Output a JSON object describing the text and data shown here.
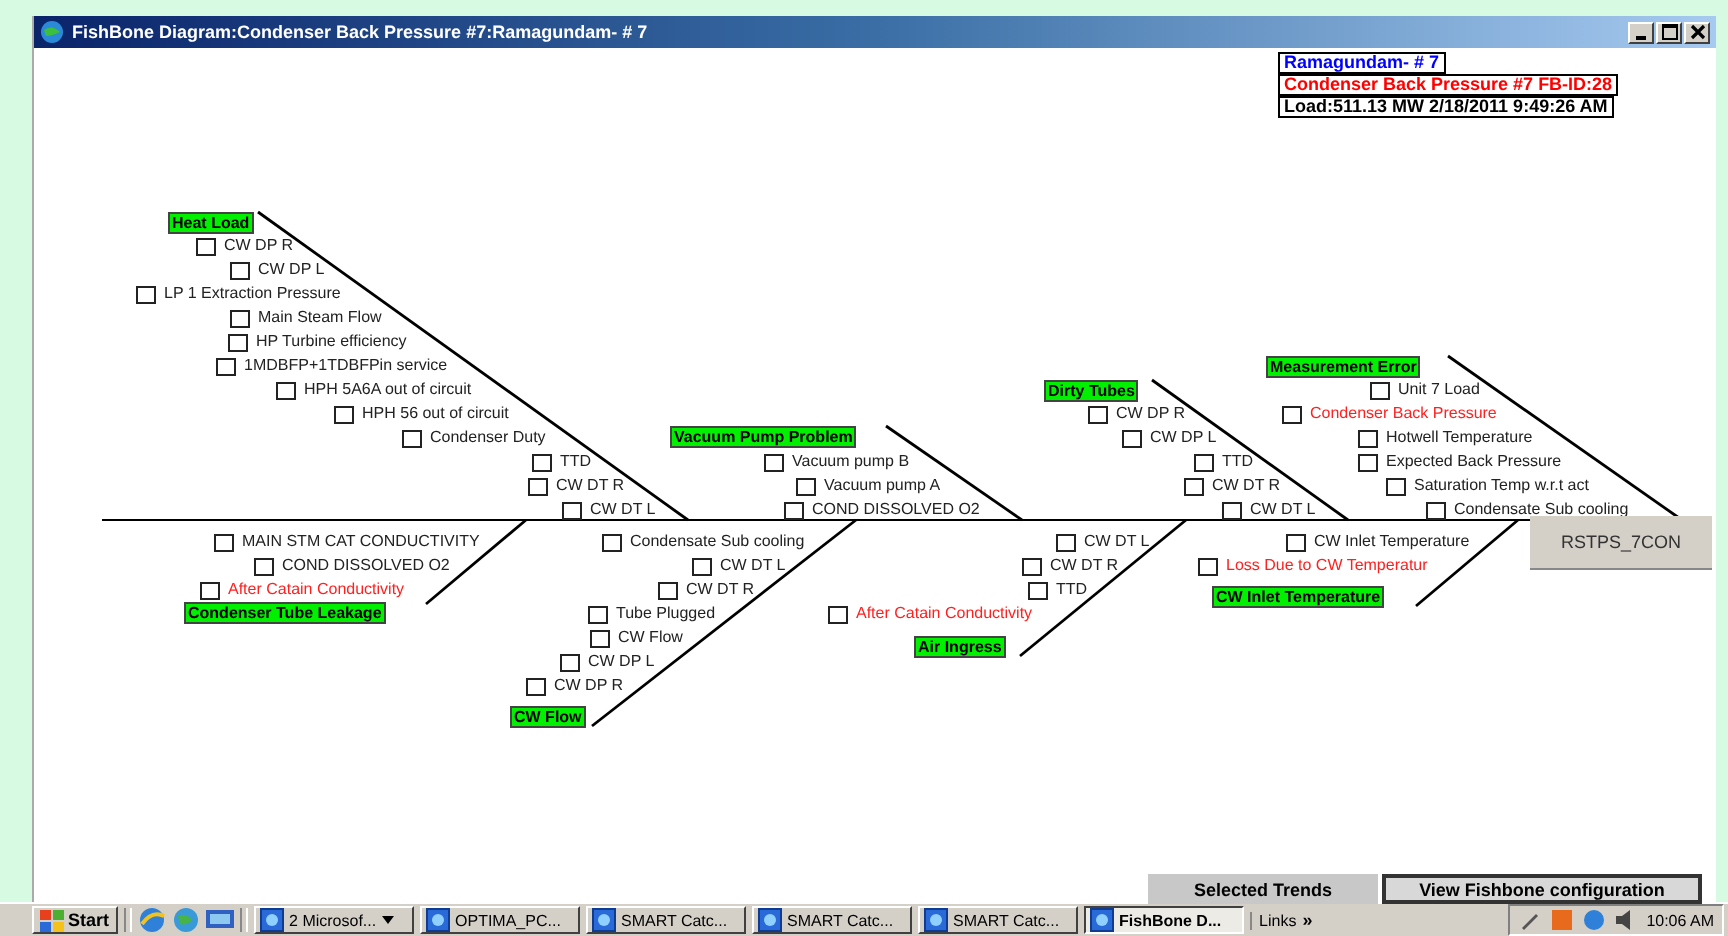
{
  "window": {
    "title": "FishBone Diagram:Condenser Back Pressure #7:Ramagundam- # 7"
  },
  "header_lines": [
    {
      "text": "Ramagundam- # 7",
      "color": "#0000ff"
    },
    {
      "text": "Condenser Back Pressure #7 FB-ID:28",
      "color": "#ff0000"
    },
    {
      "text": "Load:511.13 MW 2/18/2011 9:49:26 AM",
      "color": "#000000"
    }
  ],
  "effect": {
    "label": "RSTPS_7CON"
  },
  "bones": [
    {
      "label": "Heat Load",
      "items": [
        {
          "text": "CW DP R",
          "checked": false,
          "alert": false
        },
        {
          "text": "CW DP L",
          "checked": false,
          "alert": false
        },
        {
          "text": "LP 1 Extraction Pressure",
          "checked": false,
          "alert": false
        },
        {
          "text": "Main Steam Flow",
          "checked": false,
          "alert": false
        },
        {
          "text": "HP Turbine efficiency",
          "checked": false,
          "alert": false
        },
        {
          "text": "1MDBFP+1TDBFPin service",
          "checked": false,
          "alert": false
        },
        {
          "text": "HPH 5A6A out of circuit",
          "checked": false,
          "alert": false
        },
        {
          "text": "HPH 56 out of circuit",
          "checked": false,
          "alert": false
        },
        {
          "text": "Condenser Duty",
          "checked": false,
          "alert": false
        },
        {
          "text": "TTD",
          "checked": false,
          "alert": false
        },
        {
          "text": "CW DT R",
          "checked": false,
          "alert": false
        },
        {
          "text": "CW DT L",
          "checked": false,
          "alert": false
        }
      ]
    },
    {
      "label": "Vacuum Pump Problem",
      "items": [
        {
          "text": "Vacuum pump B",
          "checked": false,
          "alert": false
        },
        {
          "text": "Vacuum pump A",
          "checked": false,
          "alert": false
        },
        {
          "text": "COND DISSOLVED O2",
          "checked": false,
          "alert": false
        }
      ]
    },
    {
      "label": "Dirty Tubes",
      "items": [
        {
          "text": "CW DP R",
          "checked": false,
          "alert": false
        },
        {
          "text": "CW DP L",
          "checked": false,
          "alert": false
        },
        {
          "text": "TTD",
          "checked": false,
          "alert": false
        },
        {
          "text": "CW DT R",
          "checked": false,
          "alert": false
        },
        {
          "text": "CW DT L",
          "checked": false,
          "alert": false
        }
      ]
    },
    {
      "label": "Measurement Error",
      "items": [
        {
          "text": "Unit 7 Load",
          "checked": false,
          "alert": false
        },
        {
          "text": "Condenser Back Pressure",
          "checked": false,
          "alert": true
        },
        {
          "text": "Hotwell Temperature",
          "checked": false,
          "alert": false
        },
        {
          "text": "Expected Back Pressure",
          "checked": false,
          "alert": false
        },
        {
          "text": "Saturation Temp w.r.t act",
          "checked": false,
          "alert": false
        },
        {
          "text": "Condensate Sub cooling",
          "checked": false,
          "alert": false
        }
      ]
    },
    {
      "label": "Condenser Tube Leakage",
      "items": [
        {
          "text": "MAIN STM CAT CONDUCTIVITY",
          "checked": false,
          "alert": false
        },
        {
          "text": "COND DISSOLVED O2",
          "checked": false,
          "alert": false
        },
        {
          "text": "After Catain Conductivity",
          "checked": false,
          "alert": true
        }
      ]
    },
    {
      "label": "CW Flow",
      "items": [
        {
          "text": "Condensate Sub cooling",
          "checked": false,
          "alert": false
        },
        {
          "text": "CW DT L",
          "checked": false,
          "alert": false
        },
        {
          "text": "CW DT R",
          "checked": false,
          "alert": false
        },
        {
          "text": "Tube Plugged",
          "checked": false,
          "alert": false
        },
        {
          "text": "CW Flow",
          "checked": false,
          "alert": false
        },
        {
          "text": "CW DP L",
          "checked": false,
          "alert": false
        },
        {
          "text": "CW DP R",
          "checked": false,
          "alert": false
        }
      ]
    },
    {
      "label": "Air Ingress",
      "items": [
        {
          "text": "CW DT L",
          "checked": false,
          "alert": false
        },
        {
          "text": "CW DT R",
          "checked": false,
          "alert": false
        },
        {
          "text": "TTD",
          "checked": false,
          "alert": false
        },
        {
          "text": "After Catain Conductivity",
          "checked": false,
          "alert": true
        }
      ]
    },
    {
      "label": "CW Inlet Temperature",
      "items": [
        {
          "text": "CW Inlet Temperature",
          "checked": false,
          "alert": false
        },
        {
          "text": "Loss Due to CW Temperatur",
          "checked": false,
          "alert": true
        }
      ]
    }
  ],
  "bottom_buttons": [
    "Selected Trends",
    "View Fishbone configuration"
  ],
  "taskbar": {
    "start": "Start",
    "tasks": [
      {
        "label": "2 Microsof...",
        "selected": false
      },
      {
        "label": "OPTIMA_PC...",
        "selected": false
      },
      {
        "label": "SMART Catc...",
        "selected": false
      },
      {
        "label": "SMART Catc...",
        "selected": false
      },
      {
        "label": "SMART Catc...",
        "selected": false
      },
      {
        "label": "FishBone D...",
        "selected": true
      }
    ],
    "links": "Links",
    "chevron": "»",
    "clock": "10:06 AM"
  }
}
